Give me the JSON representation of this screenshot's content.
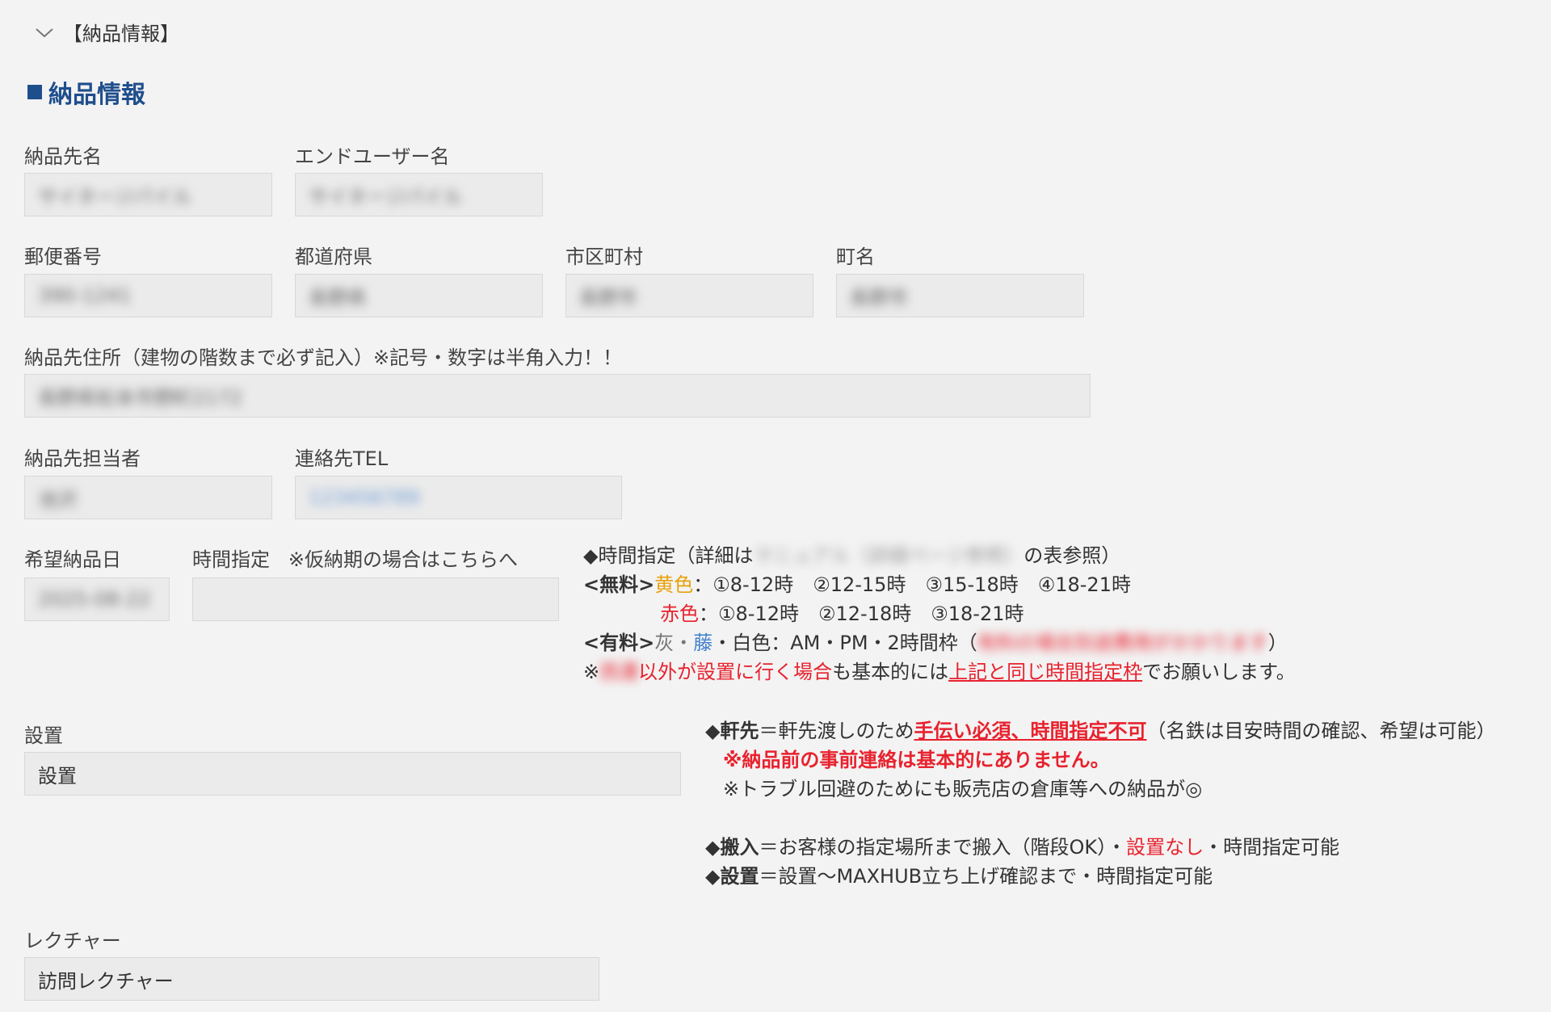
{
  "section": {
    "toggle_label": "【納品情報】",
    "title": "納品情報"
  },
  "labels": {
    "delivery_name": "納品先名",
    "end_user": "エンドユーザー名",
    "postal": "郵便番号",
    "prefecture": "都道府県",
    "city": "市区町村",
    "town": "町名",
    "address": "納品先住所（建物の階数まで必ず記入）※記号・数字は半角入力！！",
    "contact_person": "納品先担当者",
    "contact_tel": "連絡先TEL",
    "desired_date": "希望納品日",
    "time_slot": "時間指定",
    "tentative_note": "※仮納期の場合はこちらへ",
    "install": "設置",
    "lecture": "レクチャー"
  },
  "values": {
    "delivery_name": "サイネージパイル",
    "end_user": "サイネージパイル",
    "postal": "390-1241",
    "prefecture": "長野県",
    "city": "長野市",
    "town": "長野市",
    "address": "長野県松本市野町2172",
    "contact_person": "池沢",
    "contact_tel": "123456789",
    "desired_date": "2025-08-22",
    "time_slot": "",
    "install": "設置",
    "lecture": "訪問レクチャー"
  },
  "time_info": {
    "header_prefix": "◆時間指定（詳細は",
    "header_blur": "マニュアル（詳細ページ参照）",
    "header_suffix": "の表参照）",
    "free_tag": "<無料>",
    "yellow_label": "黄色",
    "yellow_slots": "：①8-12時　②12-15時　③15-18時　④18-21時",
    "red_label": "赤色",
    "red_slots": "：①8-12時　②12-18時　③18-21時",
    "paid_tag": "<有料>",
    "paid_gray": "灰・",
    "paid_fuji": "藤",
    "paid_rest": "・白色：AM・PM・2時間枠（",
    "paid_blur": "有料の場合別途費用がかかります",
    "paid_close": "）",
    "note_mark": "※",
    "note_blur": "西濃",
    "note_red": "以外が設置に行く場合",
    "note_mid": "も基本的には",
    "note_link": "上記と同じ時間指定枠",
    "note_end": "でお願いします。"
  },
  "install_info": {
    "line1_a": "◆軒先",
    "line1_b": "＝軒先渡しのため",
    "line1_c": "手伝い必須、時間指定不可",
    "line1_d": "（名鉄は目安時間の確認、希望は可能）",
    "line2": "※納品前の事前連絡は基本的にありません。",
    "line3": "※トラブル回避のためにも販売店の倉庫等への納品が◎",
    "line4_a": "◆搬入",
    "line4_b": "＝お客様の指定場所まで搬入（階段OK）・",
    "line4_c": "設置なし",
    "line4_d": "・時間指定可能",
    "line5_a": "◆設置",
    "line5_b": "＝設置～MAXHUB立ち上げ確認まで・時間指定可能"
  },
  "colors": {
    "title_blue": "#1f4e8c",
    "accent_red": "#e8222e",
    "accent_yellow": "#e8a10c",
    "accent_blue": "#3d7fcf"
  }
}
